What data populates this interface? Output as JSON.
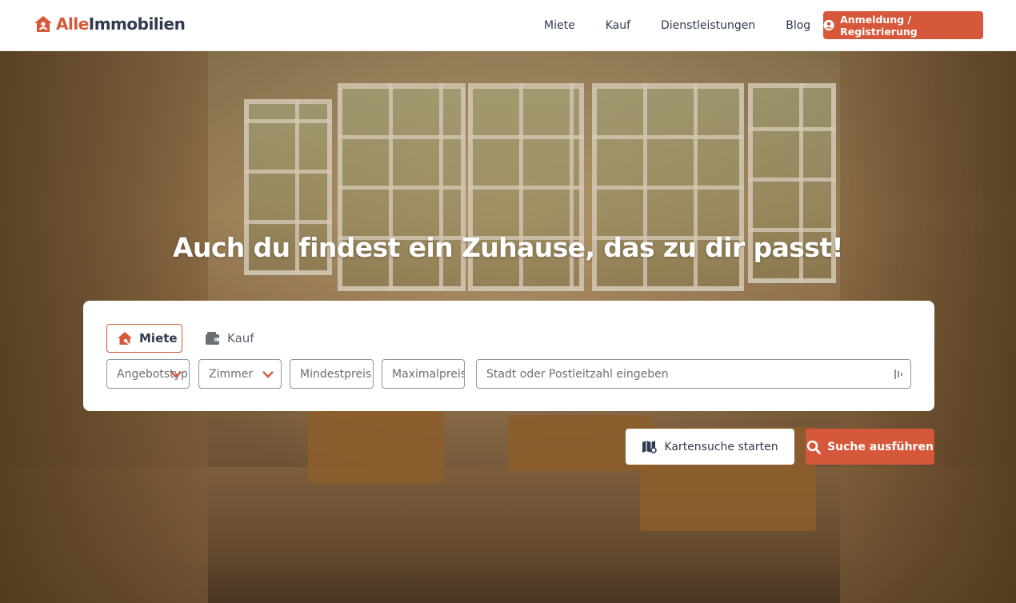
{
  "logo": {
    "part1": "Alle",
    "part2": "Immobilien"
  },
  "nav": {
    "items": [
      "Miete",
      "Kauf",
      "Dienstleistungen",
      "Blog"
    ]
  },
  "login": {
    "label": "Anmeldung / Registrierung"
  },
  "hero": {
    "headline": "Auch du findest ein Zuhause, das zu dir passt!"
  },
  "search": {
    "tabs": [
      {
        "label": "Miete"
      },
      {
        "label": "Kauf"
      }
    ],
    "fields": {
      "type": "Angebotstyp",
      "rooms": "Zimmer",
      "min_price": "Mindestpreis",
      "max_price": "Maximalpreis",
      "city": "Stadt oder Postleitzahl eingeben"
    },
    "map_button": "Kartensuche starten",
    "search_button": "Suche ausführen"
  },
  "colors": {
    "accent": "#d6583a",
    "navy": "#2f3a4f"
  }
}
